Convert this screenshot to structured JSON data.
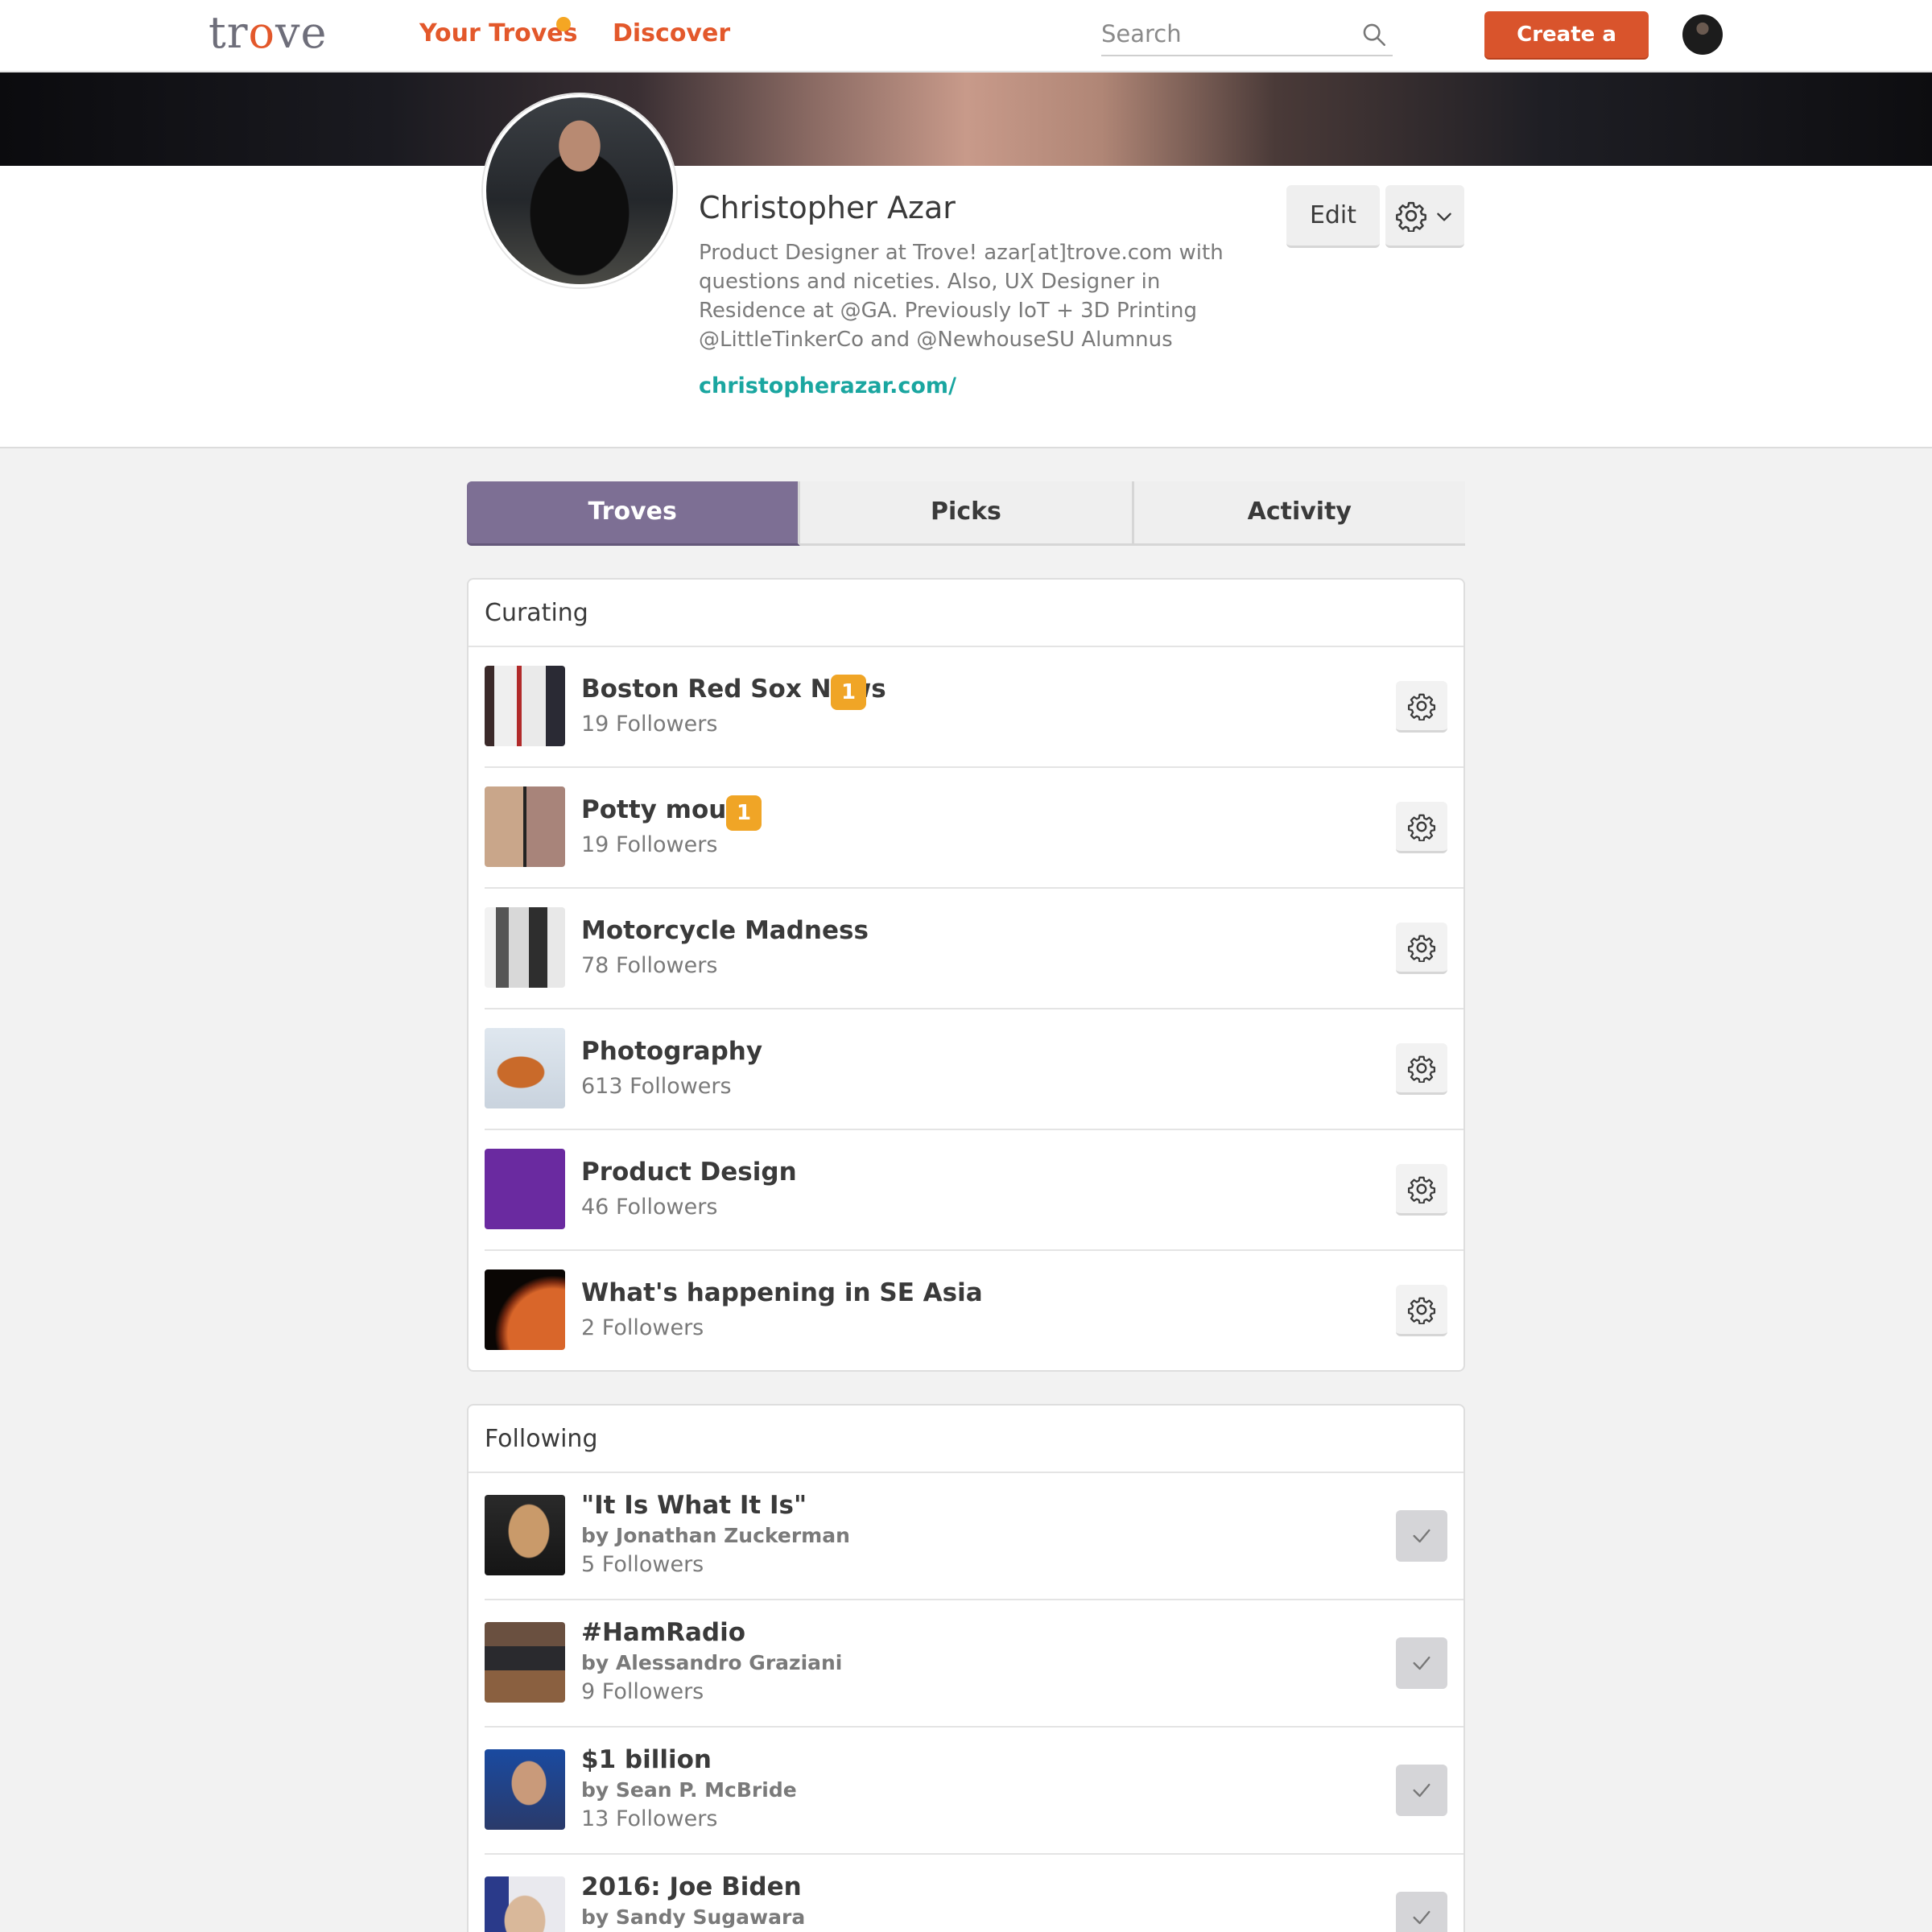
{
  "nav": {
    "logo": "trove",
    "your_troves": "Your Troves",
    "discover": "Discover",
    "search_placeholder": "Search",
    "create_button": "Create a trove"
  },
  "profile": {
    "name": "Christopher Azar",
    "bio": "Product Designer at Trove! azar[at]trove.com with questions and niceties. Also, UX Designer in Residence at @GA. Previously IoT + 3D Printing @LittleTinkerCo and @NewhouseSU Alumnus",
    "link": "christopherazar.com/",
    "edit_button": "Edit"
  },
  "tabs": [
    "Troves",
    "Picks",
    "Activity"
  ],
  "curating": {
    "title": "Curating",
    "items": [
      {
        "title": "Boston Red Sox News",
        "followers": "19 Followers",
        "badge": "1"
      },
      {
        "title": "Potty mouth",
        "followers": "19 Followers",
        "badge": "1"
      },
      {
        "title": "Motorcycle Madness",
        "followers": "78 Followers"
      },
      {
        "title": "Photography",
        "followers": "613 Followers"
      },
      {
        "title": "Product Design",
        "followers": "46 Followers"
      },
      {
        "title": "What's happening in SE Asia",
        "followers": "2 Followers"
      }
    ]
  },
  "following": {
    "title": "Following",
    "items": [
      {
        "title": "\"It Is What It Is\"",
        "by": "by Jonathan Zuckerman",
        "followers": "5 Followers"
      },
      {
        "title": "#HamRadio",
        "by": "by Alessandro Graziani",
        "followers": "9 Followers"
      },
      {
        "title": "$1 billion",
        "by": "by Sean P. McBride",
        "followers": "13 Followers"
      },
      {
        "title": "2016: Joe Biden",
        "by": "by Sandy Sugawara",
        "followers": ""
      }
    ]
  },
  "colors": {
    "accent": "#e3582b",
    "tab_active": "#7d6f94",
    "link": "#1aa6a0",
    "badge": "#f0a526"
  },
  "icons": [
    "search-icon",
    "gear-icon",
    "chevron-down-icon",
    "check-icon",
    "notification-dot"
  ]
}
